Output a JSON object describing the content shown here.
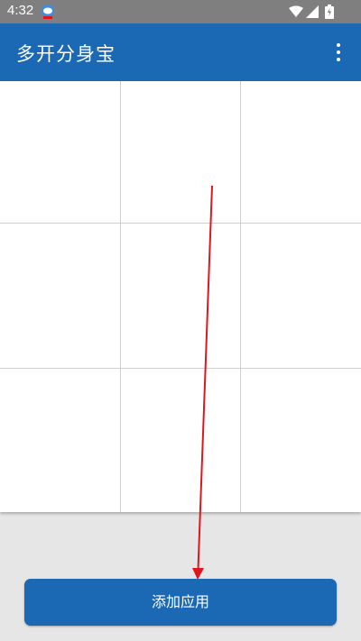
{
  "status_bar": {
    "time": "4:32",
    "icons": [
      "notification-app-icon",
      "wifi-icon",
      "signal-icon",
      "battery-icon"
    ]
  },
  "app_bar": {
    "title": "多开分身宝",
    "overflow_icon": "more-vert-icon"
  },
  "grid": {
    "rows": 3,
    "columns": 3,
    "cells": [
      "",
      "",
      "",
      "",
      "",
      "",
      "",
      "",
      ""
    ]
  },
  "annotation": {
    "type": "arrow",
    "color": "#e0161e"
  },
  "add_button": {
    "label": "添加应用"
  },
  "colors": {
    "primary": "#1b69b5",
    "status_bar": "#7f7f7f",
    "background": "#e6e6e6"
  }
}
